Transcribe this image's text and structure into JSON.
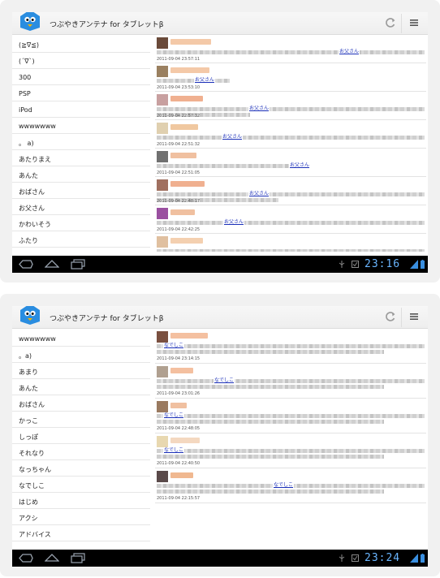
{
  "screens": [
    {
      "app_title": "つぶやきアンテナ for タブレットβ",
      "sidebar_items": [
        "(≧∇≦)",
        "(´∇`)",
        "300",
        "PSP",
        "iPod",
        "wwwwwww",
        "。 a)",
        "あたりまえ",
        "あんた",
        "おばさん",
        "お父さん",
        "かわいそう",
        "ふたり"
      ],
      "tweets": [
        {
          "avatar_color": "#6a4a3a",
          "name_color": "#f4c9a8",
          "name_w": 50,
          "mention": "お父さん",
          "timestamp": "2011-09-04 23:57:11"
        },
        {
          "avatar_color": "#9a8060",
          "name_color": "#f4c9a8",
          "name_w": 48,
          "mention": "お父さん",
          "timestamp": "2011-09-04 23:53:10"
        },
        {
          "avatar_color": "#c8a0a0",
          "name_color": "#f0b090",
          "name_w": 40,
          "mention": "お父さん",
          "timestamp": "2011-09-04 22:57:32"
        },
        {
          "avatar_color": "#e0d0b0",
          "name_color": "#f0c8a0",
          "name_w": 34,
          "mention": "お父さん",
          "timestamp": "2011-09-04 22:51:32"
        },
        {
          "avatar_color": "#707070",
          "name_color": "#f0c0a0",
          "name_w": 32,
          "mention": "お父さん",
          "timestamp": "2011-09-04 22:51:05"
        },
        {
          "avatar_color": "#a07060",
          "name_color": "#f0b090",
          "name_w": 42,
          "mention": "お父さん",
          "timestamp": "2011-09-04 22:48:17"
        },
        {
          "avatar_color": "#9a50a0",
          "name_color": "#f0c0a0",
          "name_w": 30,
          "mention": "お父さん",
          "timestamp": "2011-09-04 22:42:25"
        },
        {
          "avatar_color": "#e0c0a0",
          "name_color": "#f4d0b0",
          "name_w": 40,
          "mention": "",
          "timestamp": ""
        }
      ],
      "clock": "23:16"
    },
    {
      "app_title": "つぶやきアンテナ for タブレットβ",
      "sidebar_items": [
        "wwwwwww",
        "。a)",
        "あまり",
        "あんた",
        "おばさん",
        "かっこ",
        "しっぽ",
        "それなり",
        "なっちゃん",
        "なでしこ",
        "はじめ",
        "アクシ",
        "アドバイス"
      ],
      "tweets": [
        {
          "avatar_color": "#7a5040",
          "name_color": "#f4c0a0",
          "name_w": 46,
          "mention": "なでしこ",
          "timestamp": "2011-09-04 23:14:15"
        },
        {
          "avatar_color": "#b0a090",
          "name_color": "#f4c0a0",
          "name_w": 28,
          "mention": "なでしこ",
          "timestamp": "2011-09-04 23:01:26"
        },
        {
          "avatar_color": "#9a7a60",
          "name_color": "#f0c0a0",
          "name_w": 20,
          "mention": "なでしこ",
          "timestamp": "2011-09-04 22:48:05"
        },
        {
          "avatar_color": "#e8d8b0",
          "name_color": "#f4d8c0",
          "name_w": 36,
          "mention": "なでしこ",
          "timestamp": "2011-09-04 22:40:50"
        },
        {
          "avatar_color": "#5a4a4a",
          "name_color": "#f0b890",
          "name_w": 28,
          "mention": "なでしこ",
          "timestamp": "2011-09-04 22:15:57"
        }
      ],
      "clock": "23:24"
    }
  ]
}
